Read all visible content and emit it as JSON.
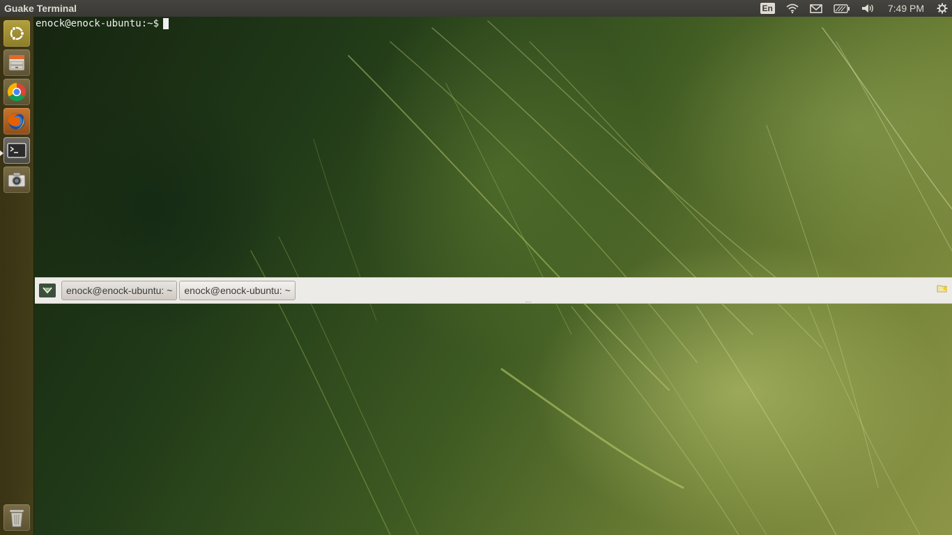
{
  "top_panel": {
    "app_title": "Guake Terminal",
    "keyboard_layout": "En",
    "clock": "7:49 PM",
    "icons": [
      "wifi-icon",
      "mail-icon",
      "battery-icon",
      "volume-icon",
      "settings-gear-icon"
    ]
  },
  "launcher": {
    "items": [
      {
        "name": "ubuntu-dash",
        "icon": "ubuntu-logo-icon"
      },
      {
        "name": "files",
        "icon": "file-cabinet-icon"
      },
      {
        "name": "chrome",
        "icon": "chrome-icon"
      },
      {
        "name": "firefox",
        "icon": "firefox-icon"
      },
      {
        "name": "terminal",
        "icon": "terminal-icon"
      },
      {
        "name": "screenshot",
        "icon": "camera-icon"
      },
      {
        "name": "trash",
        "icon": "trash-icon"
      }
    ]
  },
  "terminal": {
    "prompt": "enock@enock-ubuntu:~$"
  },
  "guake": {
    "tabs": [
      {
        "label": "enock@enock-ubuntu: ~"
      },
      {
        "label": "enock@enock-ubuntu: ~"
      }
    ]
  }
}
